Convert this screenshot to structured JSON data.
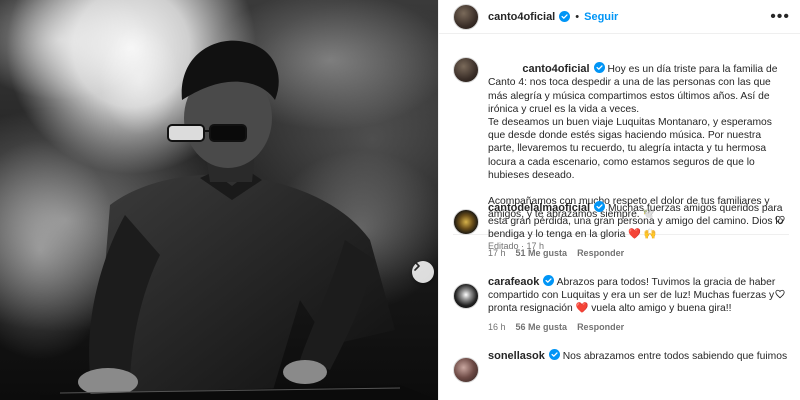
{
  "post": {
    "author": "canto4oficial",
    "follow_label": "Seguir",
    "dot": "•",
    "more_icon": "more-horizontal-icon"
  },
  "caption": {
    "author": "canto4oficial",
    "text": " Hoy es un día triste para la familia de Canto 4: nos toca despedir a una de las personas con las que más alegría y música compartimos estos últimos años. Así de irónica y cruel es la vida a veces.\nTe deseamos un buen viaje Luquitas Montanaro, y esperamos que desde donde estés sigas haciendo música. Por nuestra parte, llevaremos tu recuerdo, tu alegría intacta y tu hermosa locura a cada escenario, como estamos seguros de que lo hubieses deseado.\n\nAcompañamos con mucho respeto el dolor de tus familiares y amigos, y te abrazamos siempre. 🕊️",
    "edited": "Editado",
    "time": "17 h"
  },
  "comments": [
    {
      "author": "cantodelalmaoficial",
      "text": " Muchas fuerzas amigos queridos para esta gran pérdida, una gran persona y amigo del camino. Dios lo bendiga y lo tenga en la gloria ❤️ 🙌",
      "time": "17 h",
      "likes": "51 Me gusta",
      "reply": "Responder"
    },
    {
      "author": "carafeaok",
      "text": " Abrazos para todos! Tuvimos la gracia de haber compartido con Luquitas y era un ser de luz! Muchas fuerzas y pronta resignación ❤️ vuela alto amigo y buena gira!!",
      "time": "16 h",
      "likes": "56 Me gusta",
      "reply": "Responder"
    },
    {
      "author": "sonellasok",
      "text": " Nos abrazamos entre todos sabiendo que fuimos",
      "time": "",
      "likes": "",
      "reply": ""
    }
  ],
  "colors": {
    "link_blue": "#0095f6",
    "verified_blue": "#0095f6",
    "secondary_text": "#737373"
  }
}
